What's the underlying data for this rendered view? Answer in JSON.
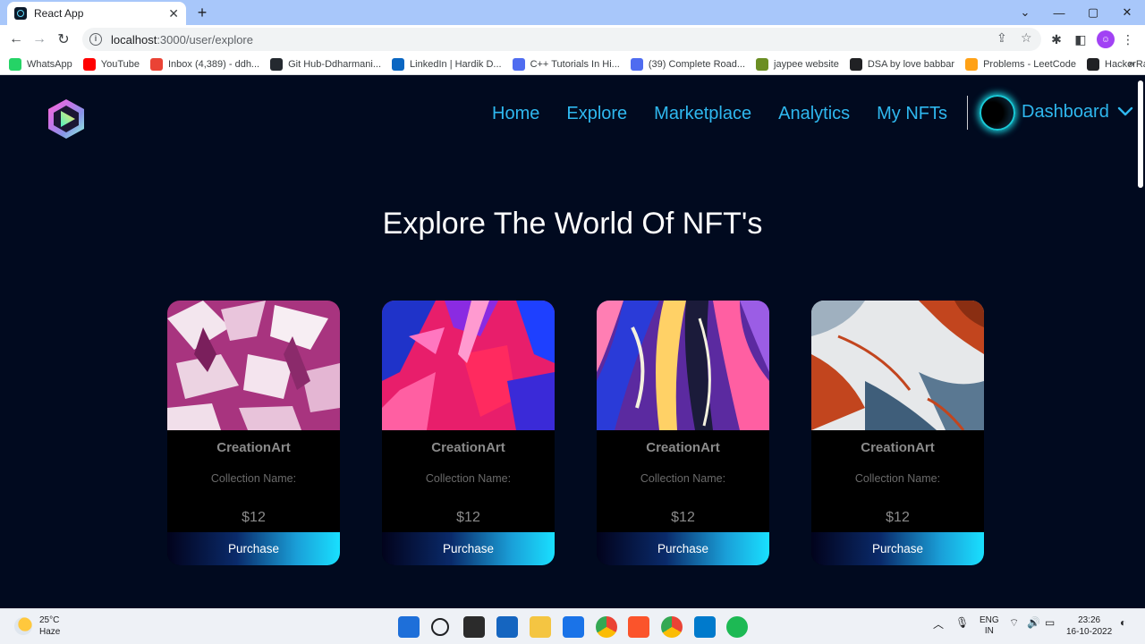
{
  "browser": {
    "tab_title": "React App",
    "tab_close": "✕",
    "new_tab": "+",
    "url_host": "localhost",
    "url_path": ":3000/user/explore",
    "bookmarks": [
      {
        "label": "WhatsApp",
        "color": "#25d366"
      },
      {
        "label": "YouTube",
        "color": "#ff0000"
      },
      {
        "label": "Inbox (4,389) - ddh...",
        "color": "#ea4335"
      },
      {
        "label": "Git Hub-Ddharmani...",
        "color": "#24292f"
      },
      {
        "label": "LinkedIn | Hardik D...",
        "color": "#0a66c2"
      },
      {
        "label": "C++ Tutorials In Hi...",
        "color": "#4f6cf0"
      },
      {
        "label": "(39) Complete Road...",
        "color": "#4f6cf0"
      },
      {
        "label": "jaypee website",
        "color": "#6b8e23"
      },
      {
        "label": "DSA by love babbar",
        "color": "#202124"
      },
      {
        "label": "Problems - LeetCode",
        "color": "#ffa116"
      },
      {
        "label": "HackerRank",
        "color": "#202124"
      }
    ],
    "more": "»"
  },
  "nav": {
    "links": [
      "Home",
      "Explore",
      "Marketplace",
      "Analytics",
      "My NFTs"
    ],
    "dashboard": "Dashboard"
  },
  "page": {
    "title": "Explore The World Of NFT's"
  },
  "cards": [
    {
      "name": "CreationArt",
      "collection": "Collection Name:",
      "price": "$12",
      "button": "Purchase"
    },
    {
      "name": "CreationArt",
      "collection": "Collection Name:",
      "price": "$12",
      "button": "Purchase"
    },
    {
      "name": "CreationArt",
      "collection": "Collection Name:",
      "price": "$12",
      "button": "Purchase"
    },
    {
      "name": "CreationArt",
      "collection": "Collection Name:",
      "price": "$12",
      "button": "Purchase"
    }
  ],
  "taskbar": {
    "temp": "25°C",
    "weather": "Haze",
    "lang": "ENG",
    "region": "IN",
    "time": "23:26",
    "date": "16-10-2022"
  },
  "colors": {
    "page_bg": "#010a1f",
    "nav_link": "#2fb8ef",
    "button_gradient_end": "#19e0ff"
  }
}
